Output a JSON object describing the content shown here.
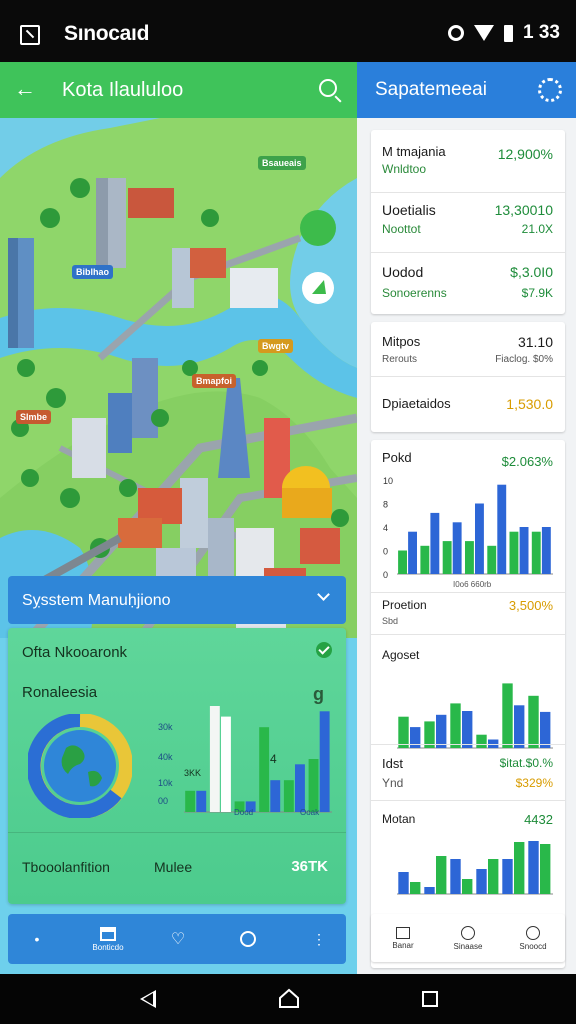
{
  "status_bar": {
    "title": "Sınocaıd",
    "time": "1 33"
  },
  "left": {
    "app_bar": {
      "title": "Kota Ilaululoo"
    },
    "map": {
      "labels": [
        "Bsaueais",
        "Biblhao",
        "Bwgtv",
        "Bmapfoi",
        "Slmbe"
      ]
    },
    "dropdown": {
      "label": "Sỵsstem Manuḥjiono"
    },
    "card": {
      "title": "Ofta Nkooaronk",
      "subtitle": "Ronaleesia",
      "badge": "g",
      "footer": {
        "left": "Tbooolanfition",
        "mid": "Mulee",
        "value": "36TK"
      },
      "mini_chart": {
        "y_ticks": [
          "30k",
          "40k",
          "10k",
          "00"
        ],
        "annotations": [
          "3KK",
          "4"
        ],
        "x_labels": [
          "Dood",
          "Ooak"
        ]
      }
    },
    "bottom_nav": {
      "home_label": "Bonticdo"
    }
  },
  "right": {
    "app_bar": {
      "title": "Sapatemeeai"
    },
    "card1": {
      "rows": [
        {
          "label": "M tmajania",
          "sub": "Wnldtoo",
          "value": "12,900%",
          "value2": ""
        },
        {
          "label": "Uoetialis",
          "sub": "Noottot",
          "value": "13,30010",
          "value2": "21.0X"
        },
        {
          "label": "Uodod",
          "sub": "Sonoerenns",
          "value": "$,3.0I0",
          "value2": "$7.9K"
        }
      ]
    },
    "card2": {
      "rows": [
        {
          "label": "Mitpos",
          "sub": "Rerouts",
          "value": "31.10",
          "value2": "Fiaclog. $0%"
        },
        {
          "label": "Dpiaetaidos",
          "sub": "",
          "value": "1,530.0",
          "value2": ""
        }
      ]
    },
    "chart1": {
      "title": "Pokd",
      "value": "$2.063%",
      "y_ticks": [
        "10",
        "8",
        "4",
        "0",
        "0"
      ],
      "x_label": "I0o6 660rb"
    },
    "row_prototion": {
      "label": "Proetion",
      "sub": "Sbd",
      "value": "3,500%"
    },
    "chart2": {
      "title": "Agoset"
    },
    "row_list": {
      "label": "Idst",
      "sub": "Ynd",
      "value": "$itat.$0.%",
      "value2": "$329%"
    },
    "chart3": {
      "title": "Motan",
      "value": "4432"
    },
    "bottom_nav": {
      "items": [
        "Banar",
        "Sinaase",
        "Snoocd"
      ]
    }
  },
  "colors": {
    "green": "#3fc35a",
    "blue": "#2a7fdb",
    "bar_blue": "#2d66d6",
    "bar_green": "#29b84a",
    "gold": "#e0a400"
  },
  "chart_data": [
    {
      "type": "bar",
      "title": "Pokd",
      "series": [
        {
          "values": [
            4.5,
            6.5,
            5.5,
            7.5,
            9.5,
            5,
            5
          ]
        },
        {
          "values": [
            2.5,
            3,
            3.5,
            3.5,
            3,
            4.5,
            4.5
          ]
        }
      ],
      "ylim": [
        0,
        10
      ]
    },
    {
      "type": "bar",
      "title": "Agoset",
      "series": [
        {
          "values": [
            2.2,
            3.5,
            3.9,
            0.9,
            4.5,
            3.8
          ]
        },
        {
          "values": [
            3.3,
            2.8,
            4.7,
            1.4,
            6.8,
            5.5
          ]
        }
      ],
      "ylim": [
        0,
        8
      ]
    },
    {
      "type": "bar",
      "title": "Motan",
      "series": [
        {
          "values": [
            1.2,
            3.8,
            1.5,
            3.5,
            5.2,
            5.0
          ]
        },
        {
          "values": [
            2.2,
            0.7,
            3.5,
            2.5,
            3.5,
            5.3
          ]
        }
      ],
      "ylim": [
        0,
        6
      ]
    },
    {
      "type": "bar",
      "title": "",
      "series": [
        {
          "values": [
            0.2,
            0.9,
            0.1,
            0.3,
            0.45,
            0.95
          ]
        },
        {
          "values": [
            0.2,
            1.0,
            0.1,
            0.8,
            0.3,
            0.5
          ]
        }
      ],
      "ylim": [
        0,
        1
      ]
    }
  ]
}
